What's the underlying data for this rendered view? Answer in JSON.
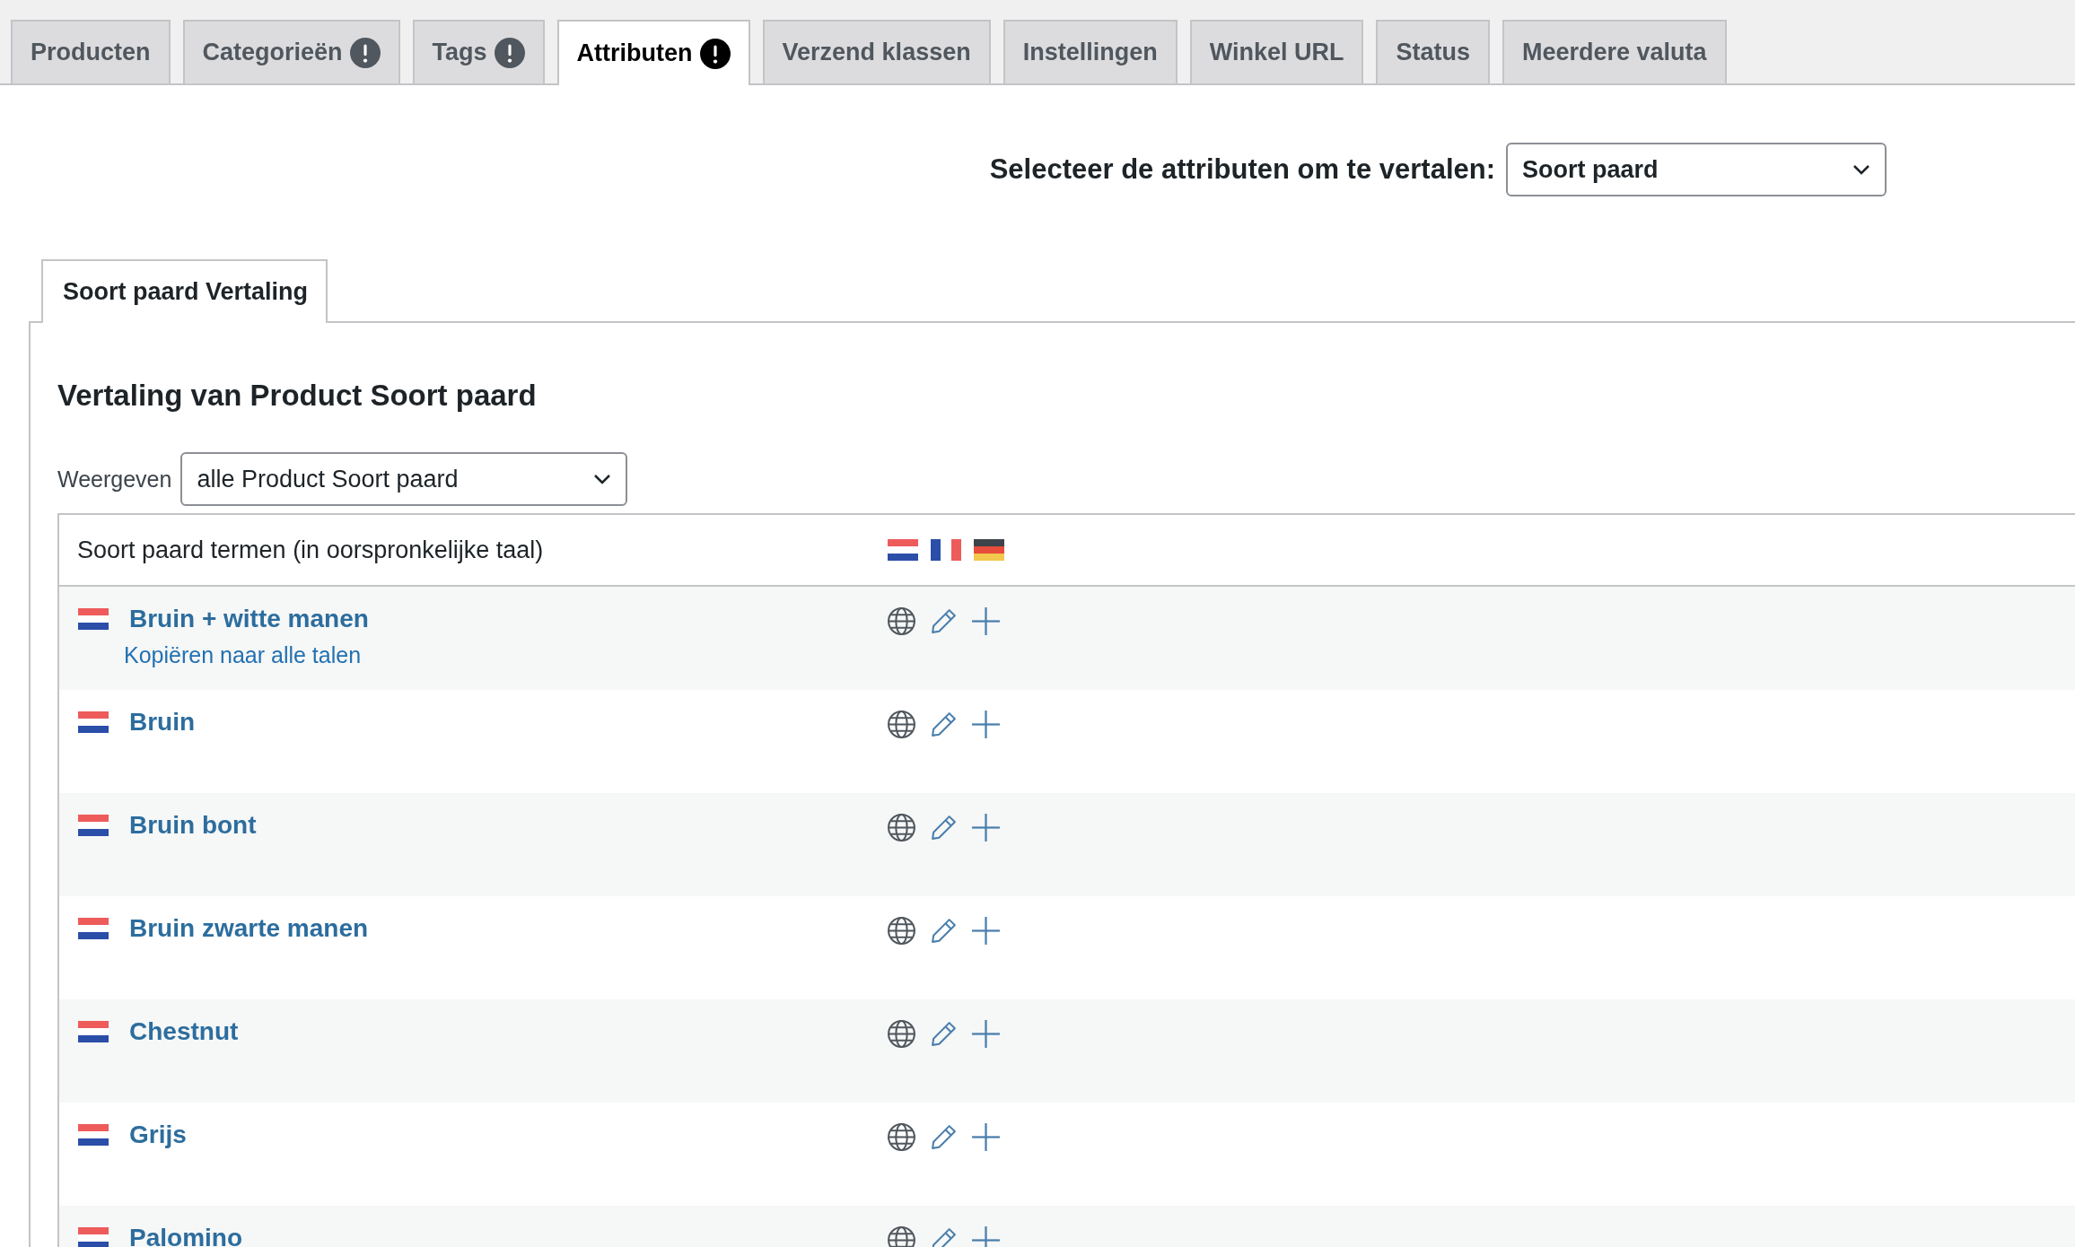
{
  "tabs": [
    {
      "label": "Producten",
      "selected": false,
      "alert": false
    },
    {
      "label": "Categorieën",
      "selected": false,
      "alert": true
    },
    {
      "label": "Tags",
      "selected": false,
      "alert": true
    },
    {
      "label": "Attributen",
      "selected": true,
      "alert": true
    },
    {
      "label": "Verzend klassen",
      "selected": false,
      "alert": false
    },
    {
      "label": "Instellingen",
      "selected": false,
      "alert": false
    },
    {
      "label": "Winkel URL",
      "selected": false,
      "alert": false
    },
    {
      "label": "Status",
      "selected": false,
      "alert": false
    },
    {
      "label": "Meerdere valuta",
      "selected": false,
      "alert": false
    }
  ],
  "attribute_select": {
    "label": "Selecteer de attributen om te vertalen:",
    "value": "Soort paard"
  },
  "panel_tab": {
    "label": "Soort paard Vertaling"
  },
  "heading": "Vertaling van Product Soort paard",
  "filter": {
    "label": "Weergeven",
    "value": "alle Product Soort paard"
  },
  "table": {
    "header": "Soort paard termen (in oorspronkelijke taal)",
    "rows": [
      {
        "name": "Bruin + witte manen",
        "copy_link": "Kopiëren naar alle talen"
      },
      {
        "name": "Bruin"
      },
      {
        "name": "Bruin bont"
      },
      {
        "name": "Bruin zwarte manen"
      },
      {
        "name": "Chestnut"
      },
      {
        "name": "Grijs"
      },
      {
        "name": "Palomino"
      }
    ]
  }
}
